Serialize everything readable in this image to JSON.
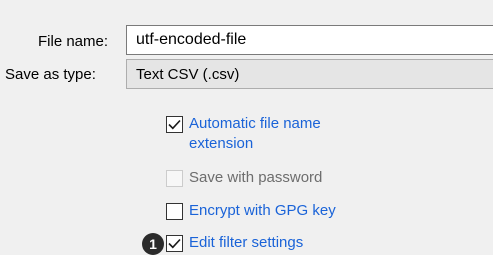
{
  "fields": {
    "file_name_label": "File name:",
    "file_name_value": "utf-encoded-file",
    "save_type_label": "Save as type:",
    "save_type_value": "Text CSV (.csv)"
  },
  "options": {
    "auto_ext": {
      "label": "Automatic file name extension",
      "checked": true
    },
    "password": {
      "label": "Save with password",
      "checked": false,
      "disabled": true
    },
    "gpg": {
      "label": "Encrypt with GPG key",
      "checked": false
    },
    "filter": {
      "label": "Edit filter settings",
      "checked": true
    }
  },
  "callout": {
    "number": "1"
  },
  "colors": {
    "link": "#1a63d8",
    "disabled_text": "#6d6d6d",
    "background": "#f0f0f0"
  }
}
